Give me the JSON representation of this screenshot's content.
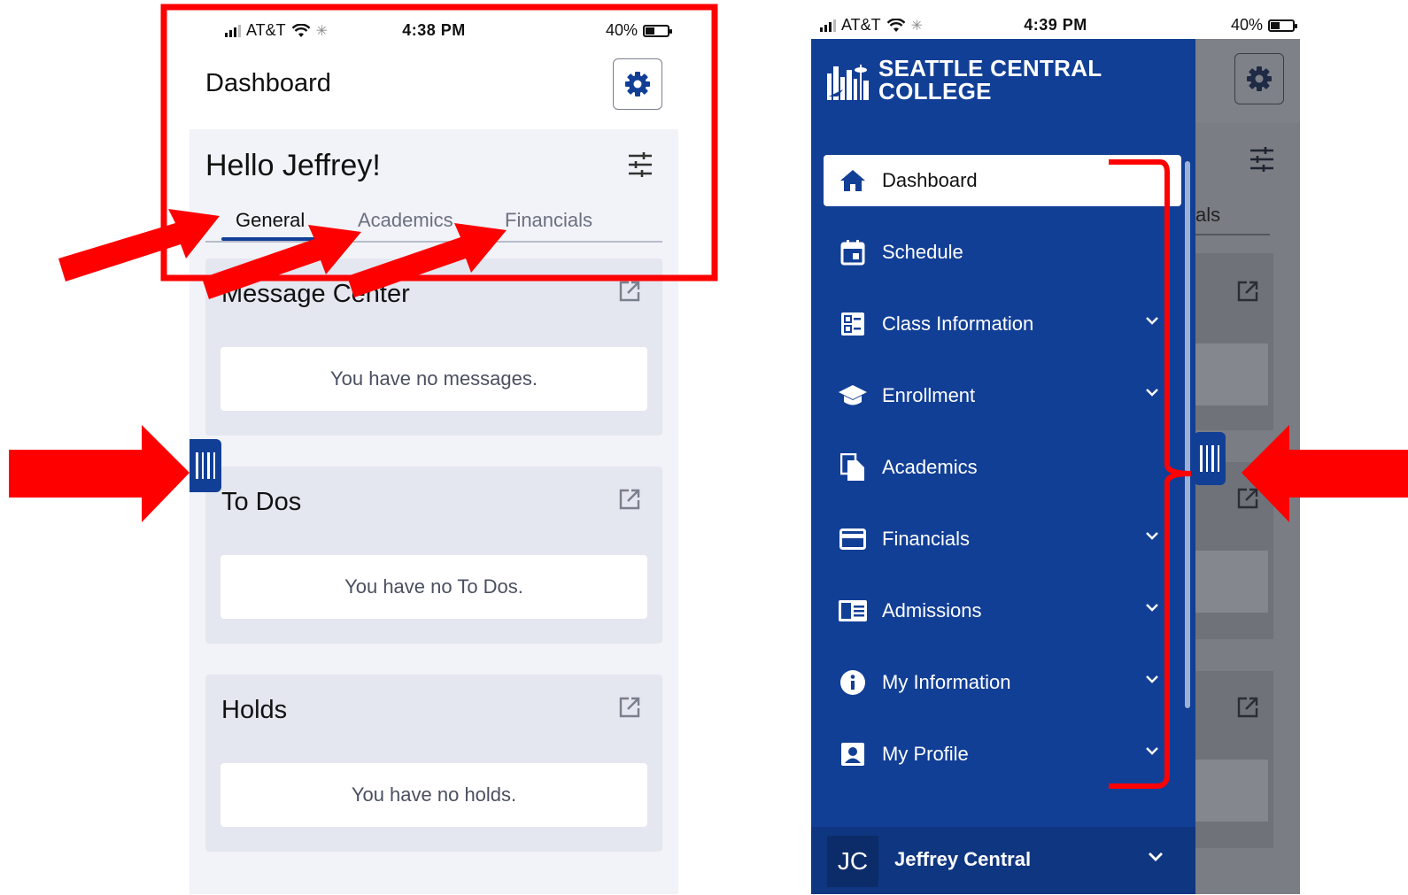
{
  "left_screen": {
    "status": {
      "carrier": "AT&T",
      "time": "4:38 PM",
      "battery": "40%"
    },
    "header": {
      "title": "Dashboard"
    },
    "greeting": "Hello Jeffrey!",
    "tabs": [
      {
        "label": "General",
        "active": true
      },
      {
        "label": "Academics",
        "active": false
      },
      {
        "label": "Financials",
        "active": false
      }
    ],
    "cards": [
      {
        "title": "Message Center",
        "empty_text": "You have no messages."
      },
      {
        "title": "To Dos",
        "empty_text": "You have no To Dos."
      },
      {
        "title": "Holds",
        "empty_text": "You have no holds."
      }
    ]
  },
  "right_screen": {
    "status": {
      "carrier": "AT&T",
      "time": "4:39 PM",
      "battery": "40%"
    },
    "brand": {
      "line1": "SEATTLE CENTRAL",
      "line2": "COLLEGE"
    },
    "nav_items": [
      {
        "label": "Dashboard",
        "icon": "home-icon",
        "active": true,
        "expandable": false
      },
      {
        "label": "Schedule",
        "icon": "calendar-icon",
        "active": false,
        "expandable": false
      },
      {
        "label": "Class Information",
        "icon": "dashboard-grid-icon",
        "active": false,
        "expandable": true
      },
      {
        "label": "Enrollment",
        "icon": "graduation-cap-icon",
        "active": false,
        "expandable": true
      },
      {
        "label": "Academics",
        "icon": "documents-icon",
        "active": false,
        "expandable": false
      },
      {
        "label": "Financials",
        "icon": "credit-card-icon",
        "active": false,
        "expandable": true
      },
      {
        "label": "Admissions",
        "icon": "id-card-icon",
        "active": false,
        "expandable": true
      },
      {
        "label": "My Information",
        "icon": "info-icon",
        "active": false,
        "expandable": true
      },
      {
        "label": "My Profile",
        "icon": "profile-icon",
        "active": false,
        "expandable": true
      }
    ],
    "user": {
      "initials": "JC",
      "name": "Jeffrey Central"
    },
    "background_tab_fragment": "als"
  },
  "colors": {
    "brand_blue": "#123f96",
    "annotation_red": "#ff0000",
    "card_bg": "#e4e6f0",
    "page_bg": "#f2f3f8"
  }
}
